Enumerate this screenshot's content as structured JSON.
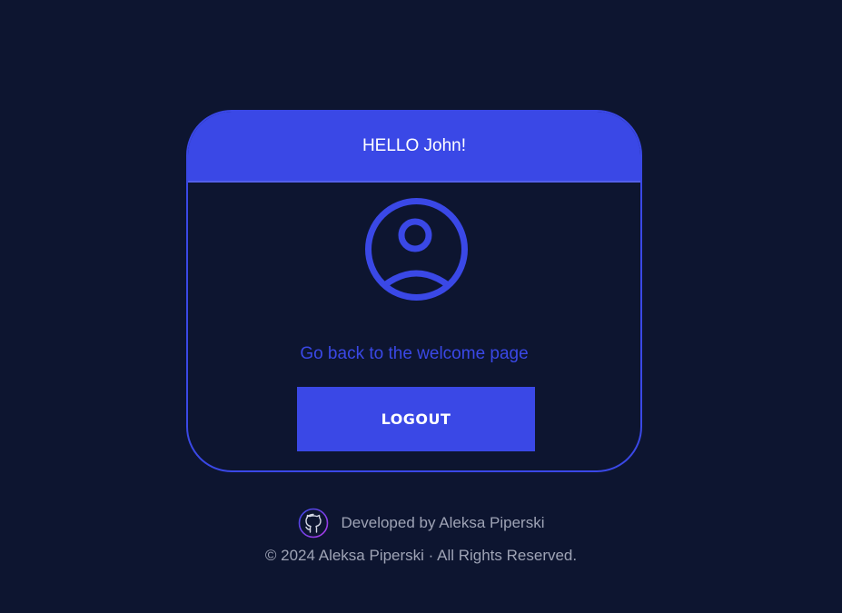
{
  "colors": {
    "background": "#0d1530",
    "accent": "#3a48e6",
    "footer_text": "#9ea3b5",
    "white": "#ffffff"
  },
  "card": {
    "greeting": "HELLO John!",
    "avatar_icon": "user-circle-icon",
    "back_link": "Go back to the welcome page",
    "logout_label": "LOGOUT"
  },
  "footer": {
    "github_icon": "github-icon",
    "developed_by": "Developed by Aleksa Piperski",
    "copyright": "© 2024 Aleksa Piperski · All Rights Reserved."
  }
}
